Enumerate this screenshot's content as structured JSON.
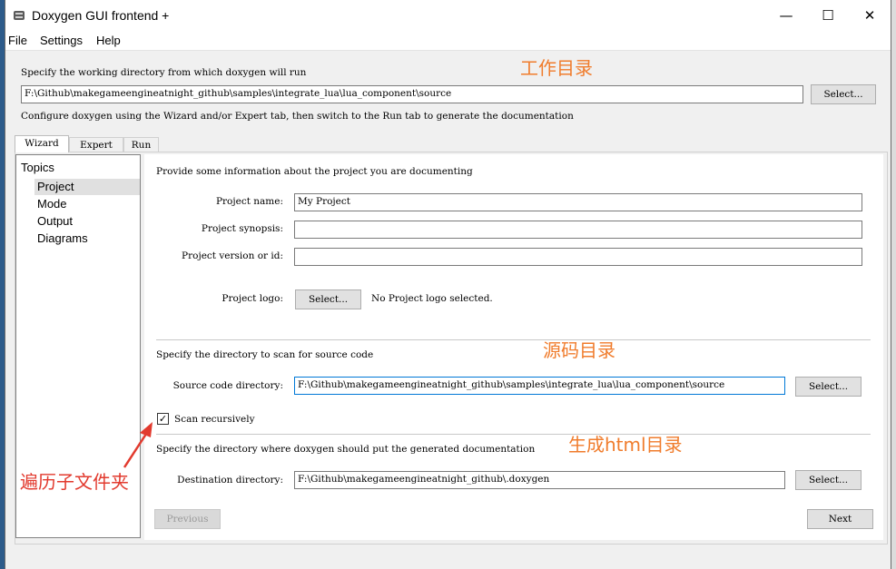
{
  "window": {
    "title": "Doxygen GUI frontend +",
    "min_icon": "minimize-icon",
    "max_icon": "maximize-icon",
    "close_icon": "close-icon"
  },
  "menu": [
    "File",
    "Settings",
    "Help"
  ],
  "working_dir": {
    "label": "Specify the working directory from which doxygen will run",
    "value": "F:\\Github\\makegameengineatnight_github\\samples\\integrate_lua\\lua_component\\source",
    "select_label": "Select...",
    "hint": "Configure doxygen using the Wizard and/or Expert tab, then switch to the Run tab to generate the documentation"
  },
  "tabs": [
    "Wizard",
    "Expert",
    "Run"
  ],
  "topics": {
    "heading": "Topics",
    "items": [
      "Project",
      "Mode",
      "Output",
      "Diagrams"
    ]
  },
  "project": {
    "intro": "Provide some information about the project you are documenting",
    "name_label": "Project name:",
    "name_value": "My Project",
    "synopsis_label": "Project synopsis:",
    "synopsis_value": "",
    "version_label": "Project version or id:",
    "version_value": "",
    "logo_label": "Project logo:",
    "logo_select": "Select...",
    "logo_status": "No Project logo selected."
  },
  "source": {
    "intro": "Specify the directory to scan for source code",
    "label": "Source code directory:",
    "value": "F:\\Github\\makegameengineatnight_github\\samples\\integrate_lua\\lua_component\\source",
    "select_label": "Select...",
    "recursive_label": "Scan recursively",
    "recursive_checked": "✓"
  },
  "destination": {
    "intro": "Specify the directory where doxygen should put the generated documentation",
    "label": "Destination directory:",
    "value": "F:\\Github\\makegameengineatnight_github\\.doxygen",
    "select_label": "Select..."
  },
  "nav": {
    "previous": "Previous",
    "next": "Next"
  },
  "annotations": {
    "working_dir": "工作目录",
    "source_dir": "源码目录",
    "html_dir": "生成html目录",
    "recursive": "遍历子文件夹"
  },
  "colors": {
    "annotation": "#f07c2c",
    "annotation_red": "#e23a2e"
  }
}
